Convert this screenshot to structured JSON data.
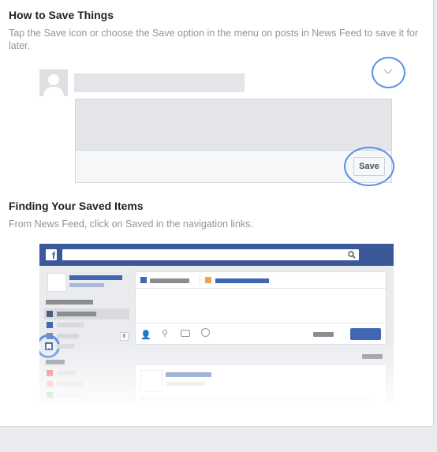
{
  "section1": {
    "title": "How to Save Things",
    "description": "Tap the Save icon or choose the Save option in the menu on posts in News Feed to save it for later."
  },
  "mock_post": {
    "save_button_label": "Save",
    "menu_icon": "chevron-down-icon"
  },
  "section2": {
    "title": "Finding Your Saved Items",
    "description": "From News Feed, click on Saved in the navigation links."
  },
  "mock_feed": {
    "logo_letter": "f",
    "search_icon": "search-icon",
    "count_badge": "6",
    "colors": {
      "topbar": "#3b5998",
      "accent_circle": "#5b8fe6",
      "saved_icon": "#4267b2"
    }
  }
}
